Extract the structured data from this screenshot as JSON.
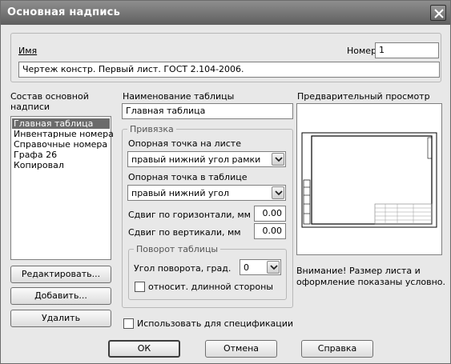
{
  "window": {
    "title": "Основная надпись"
  },
  "header": {
    "name_label": "Имя",
    "number_label": "Номер",
    "number_value": "1",
    "name_value": "Чертеж констр. Первый лист. ГОСТ 2.104-2006."
  },
  "composition": {
    "label_line1": "Состав основной",
    "label_line2": "надписи",
    "items": [
      "Главная таблица",
      "Инвентарные номера",
      "Справочные номера",
      "Графа 26",
      "Копировал"
    ],
    "selected_index": 0
  },
  "table": {
    "name_label": "Наименование таблицы",
    "name_value": "Главная таблица"
  },
  "anchor": {
    "group_label": "Привязка",
    "sheet_point_label": "Опорная точка на листе",
    "sheet_point_value": "правый нижний угол рамки",
    "table_point_label": "Опорная точка в таблице",
    "table_point_value": "правый нижний угол",
    "hshift_label": "Сдвиг по горизонтали, мм",
    "hshift_value": "0.00",
    "vshift_label": "Сдвиг по вертикали, мм",
    "vshift_value": "0.00"
  },
  "rotation": {
    "group_label": "Поворот таблицы",
    "angle_label": "Угол поворота, град.",
    "angle_value": "0",
    "relative_label": "относит. длинной стороны",
    "relative_checked": false
  },
  "preview": {
    "label": "Предварительный просмотр",
    "note_line1": "Внимание! Размер листа и",
    "note_line2": "оформление показаны условно."
  },
  "buttons": {
    "edit": "Редактировать...",
    "add": "Добавить...",
    "delete": "Удалить",
    "ok": "ОК",
    "cancel": "Отмена",
    "help": "Справка"
  },
  "spec": {
    "label": "Использовать для спецификации",
    "checked": false
  }
}
